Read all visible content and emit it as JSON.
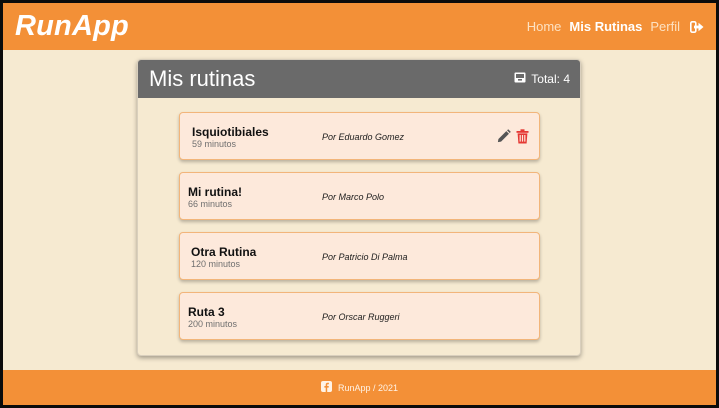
{
  "app": {
    "brand": "RunApp"
  },
  "nav": {
    "home": "Home",
    "routines": "Mis Rutinas",
    "profile": "Perfil"
  },
  "card": {
    "title": "Mis rutinas",
    "total": "Total: 4"
  },
  "routines": [
    {
      "name": "Isquiotibiales",
      "duration": "59 minutos",
      "author": "Por Eduardo Gomez"
    },
    {
      "name": "Mi rutina!",
      "duration": "66 minutos",
      "author": "Por Marco Polo"
    },
    {
      "name": "Otra Rutina",
      "duration": "120 minutos",
      "author": "Por Patricio Di Palma"
    },
    {
      "name": "Ruta 3",
      "duration": "200 minutos",
      "author": "Por Orscar Ruggeri"
    }
  ],
  "footer": {
    "text": "RunApp / 2021"
  },
  "icons": {
    "logout": "sign-out-icon",
    "total": "inbox-icon",
    "edit": "pencil-icon",
    "delete": "trash-icon",
    "footer": "facebook-icon"
  },
  "colors": {
    "accent": "#f39037",
    "background": "#f6ead1",
    "card_header": "#6a6a6a",
    "routine_bg": "#fde9db",
    "edit_icon": "#555555",
    "delete_icon": "#e53935"
  }
}
